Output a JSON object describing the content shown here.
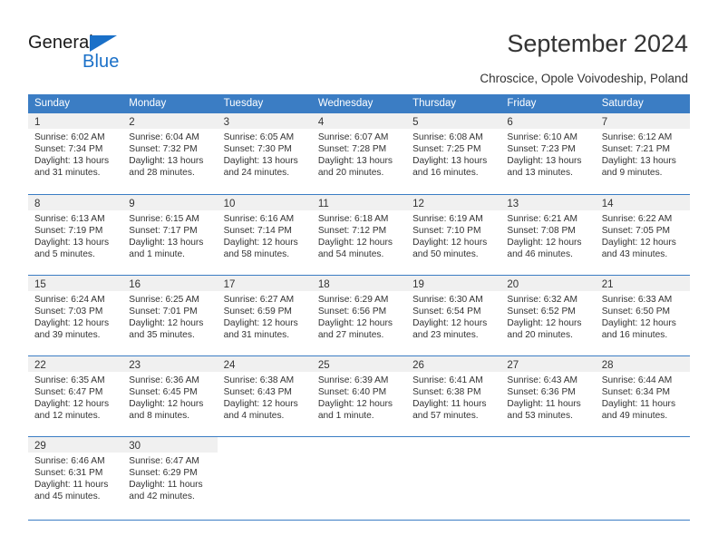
{
  "brand": {
    "name_part1": "General",
    "name_part2": "Blue",
    "accent_color": "#1a70c8",
    "triangle_icon": "triangle-icon"
  },
  "header": {
    "title": "September 2024",
    "subtitle": "Chroscice, Opole Voivodeship, Poland"
  },
  "calendar": {
    "header_bg": "#3b7dc4",
    "day_band_bg": "#f0f0f0",
    "weekdays": [
      "Sunday",
      "Monday",
      "Tuesday",
      "Wednesday",
      "Thursday",
      "Friday",
      "Saturday"
    ],
    "weeks": [
      [
        {
          "day": "1",
          "sunrise": "Sunrise: 6:02 AM",
          "sunset": "Sunset: 7:34 PM",
          "daylight_line1": "Daylight: 13 hours",
          "daylight_line2": "and 31 minutes."
        },
        {
          "day": "2",
          "sunrise": "Sunrise: 6:04 AM",
          "sunset": "Sunset: 7:32 PM",
          "daylight_line1": "Daylight: 13 hours",
          "daylight_line2": "and 28 minutes."
        },
        {
          "day": "3",
          "sunrise": "Sunrise: 6:05 AM",
          "sunset": "Sunset: 7:30 PM",
          "daylight_line1": "Daylight: 13 hours",
          "daylight_line2": "and 24 minutes."
        },
        {
          "day": "4",
          "sunrise": "Sunrise: 6:07 AM",
          "sunset": "Sunset: 7:28 PM",
          "daylight_line1": "Daylight: 13 hours",
          "daylight_line2": "and 20 minutes."
        },
        {
          "day": "5",
          "sunrise": "Sunrise: 6:08 AM",
          "sunset": "Sunset: 7:25 PM",
          "daylight_line1": "Daylight: 13 hours",
          "daylight_line2": "and 16 minutes."
        },
        {
          "day": "6",
          "sunrise": "Sunrise: 6:10 AM",
          "sunset": "Sunset: 7:23 PM",
          "daylight_line1": "Daylight: 13 hours",
          "daylight_line2": "and 13 minutes."
        },
        {
          "day": "7",
          "sunrise": "Sunrise: 6:12 AM",
          "sunset": "Sunset: 7:21 PM",
          "daylight_line1": "Daylight: 13 hours",
          "daylight_line2": "and 9 minutes."
        }
      ],
      [
        {
          "day": "8",
          "sunrise": "Sunrise: 6:13 AM",
          "sunset": "Sunset: 7:19 PM",
          "daylight_line1": "Daylight: 13 hours",
          "daylight_line2": "and 5 minutes."
        },
        {
          "day": "9",
          "sunrise": "Sunrise: 6:15 AM",
          "sunset": "Sunset: 7:17 PM",
          "daylight_line1": "Daylight: 13 hours",
          "daylight_line2": "and 1 minute."
        },
        {
          "day": "10",
          "sunrise": "Sunrise: 6:16 AM",
          "sunset": "Sunset: 7:14 PM",
          "daylight_line1": "Daylight: 12 hours",
          "daylight_line2": "and 58 minutes."
        },
        {
          "day": "11",
          "sunrise": "Sunrise: 6:18 AM",
          "sunset": "Sunset: 7:12 PM",
          "daylight_line1": "Daylight: 12 hours",
          "daylight_line2": "and 54 minutes."
        },
        {
          "day": "12",
          "sunrise": "Sunrise: 6:19 AM",
          "sunset": "Sunset: 7:10 PM",
          "daylight_line1": "Daylight: 12 hours",
          "daylight_line2": "and 50 minutes."
        },
        {
          "day": "13",
          "sunrise": "Sunrise: 6:21 AM",
          "sunset": "Sunset: 7:08 PM",
          "daylight_line1": "Daylight: 12 hours",
          "daylight_line2": "and 46 minutes."
        },
        {
          "day": "14",
          "sunrise": "Sunrise: 6:22 AM",
          "sunset": "Sunset: 7:05 PM",
          "daylight_line1": "Daylight: 12 hours",
          "daylight_line2": "and 43 minutes."
        }
      ],
      [
        {
          "day": "15",
          "sunrise": "Sunrise: 6:24 AM",
          "sunset": "Sunset: 7:03 PM",
          "daylight_line1": "Daylight: 12 hours",
          "daylight_line2": "and 39 minutes."
        },
        {
          "day": "16",
          "sunrise": "Sunrise: 6:25 AM",
          "sunset": "Sunset: 7:01 PM",
          "daylight_line1": "Daylight: 12 hours",
          "daylight_line2": "and 35 minutes."
        },
        {
          "day": "17",
          "sunrise": "Sunrise: 6:27 AM",
          "sunset": "Sunset: 6:59 PM",
          "daylight_line1": "Daylight: 12 hours",
          "daylight_line2": "and 31 minutes."
        },
        {
          "day": "18",
          "sunrise": "Sunrise: 6:29 AM",
          "sunset": "Sunset: 6:56 PM",
          "daylight_line1": "Daylight: 12 hours",
          "daylight_line2": "and 27 minutes."
        },
        {
          "day": "19",
          "sunrise": "Sunrise: 6:30 AM",
          "sunset": "Sunset: 6:54 PM",
          "daylight_line1": "Daylight: 12 hours",
          "daylight_line2": "and 23 minutes."
        },
        {
          "day": "20",
          "sunrise": "Sunrise: 6:32 AM",
          "sunset": "Sunset: 6:52 PM",
          "daylight_line1": "Daylight: 12 hours",
          "daylight_line2": "and 20 minutes."
        },
        {
          "day": "21",
          "sunrise": "Sunrise: 6:33 AM",
          "sunset": "Sunset: 6:50 PM",
          "daylight_line1": "Daylight: 12 hours",
          "daylight_line2": "and 16 minutes."
        }
      ],
      [
        {
          "day": "22",
          "sunrise": "Sunrise: 6:35 AM",
          "sunset": "Sunset: 6:47 PM",
          "daylight_line1": "Daylight: 12 hours",
          "daylight_line2": "and 12 minutes."
        },
        {
          "day": "23",
          "sunrise": "Sunrise: 6:36 AM",
          "sunset": "Sunset: 6:45 PM",
          "daylight_line1": "Daylight: 12 hours",
          "daylight_line2": "and 8 minutes."
        },
        {
          "day": "24",
          "sunrise": "Sunrise: 6:38 AM",
          "sunset": "Sunset: 6:43 PM",
          "daylight_line1": "Daylight: 12 hours",
          "daylight_line2": "and 4 minutes."
        },
        {
          "day": "25",
          "sunrise": "Sunrise: 6:39 AM",
          "sunset": "Sunset: 6:40 PM",
          "daylight_line1": "Daylight: 12 hours",
          "daylight_line2": "and 1 minute."
        },
        {
          "day": "26",
          "sunrise": "Sunrise: 6:41 AM",
          "sunset": "Sunset: 6:38 PM",
          "daylight_line1": "Daylight: 11 hours",
          "daylight_line2": "and 57 minutes."
        },
        {
          "day": "27",
          "sunrise": "Sunrise: 6:43 AM",
          "sunset": "Sunset: 6:36 PM",
          "daylight_line1": "Daylight: 11 hours",
          "daylight_line2": "and 53 minutes."
        },
        {
          "day": "28",
          "sunrise": "Sunrise: 6:44 AM",
          "sunset": "Sunset: 6:34 PM",
          "daylight_line1": "Daylight: 11 hours",
          "daylight_line2": "and 49 minutes."
        }
      ],
      [
        {
          "day": "29",
          "sunrise": "Sunrise: 6:46 AM",
          "sunset": "Sunset: 6:31 PM",
          "daylight_line1": "Daylight: 11 hours",
          "daylight_line2": "and 45 minutes."
        },
        {
          "day": "30",
          "sunrise": "Sunrise: 6:47 AM",
          "sunset": "Sunset: 6:29 PM",
          "daylight_line1": "Daylight: 11 hours",
          "daylight_line2": "and 42 minutes."
        },
        {
          "day": "",
          "sunrise": "",
          "sunset": "",
          "daylight_line1": "",
          "daylight_line2": ""
        },
        {
          "day": "",
          "sunrise": "",
          "sunset": "",
          "daylight_line1": "",
          "daylight_line2": ""
        },
        {
          "day": "",
          "sunrise": "",
          "sunset": "",
          "daylight_line1": "",
          "daylight_line2": ""
        },
        {
          "day": "",
          "sunrise": "",
          "sunset": "",
          "daylight_line1": "",
          "daylight_line2": ""
        },
        {
          "day": "",
          "sunrise": "",
          "sunset": "",
          "daylight_line1": "",
          "daylight_line2": ""
        }
      ]
    ]
  }
}
